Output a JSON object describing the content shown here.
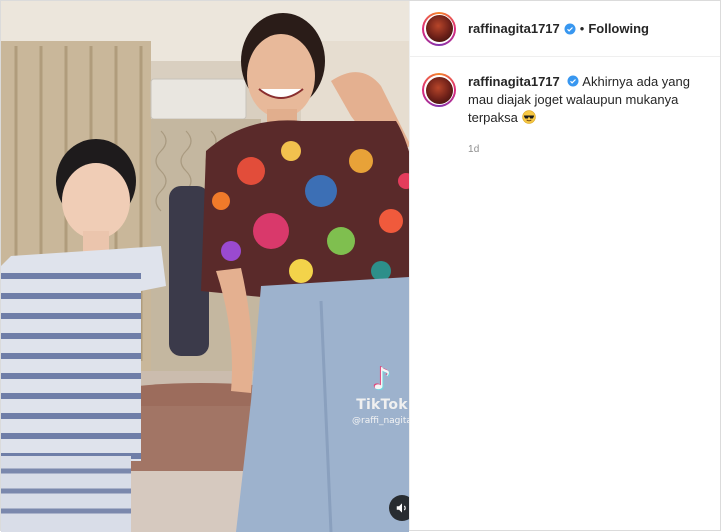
{
  "post": {
    "username": "raffinagita1717",
    "follow_state": "Following",
    "separator": "•",
    "caption": "Akhirnya ada yang mau diajak joget walaupun mukanya terpaksa",
    "caption_emoji": "sunglasses-face",
    "timestamp": "1d"
  },
  "video": {
    "watermark_logo": "♪",
    "watermark_name": "TikTok",
    "watermark_user": "@raffi_nagita",
    "audio_icon": "speaker-icon"
  },
  "colors": {
    "verified_badge": "#3897f0",
    "story_ring": "#dd2a7b"
  }
}
